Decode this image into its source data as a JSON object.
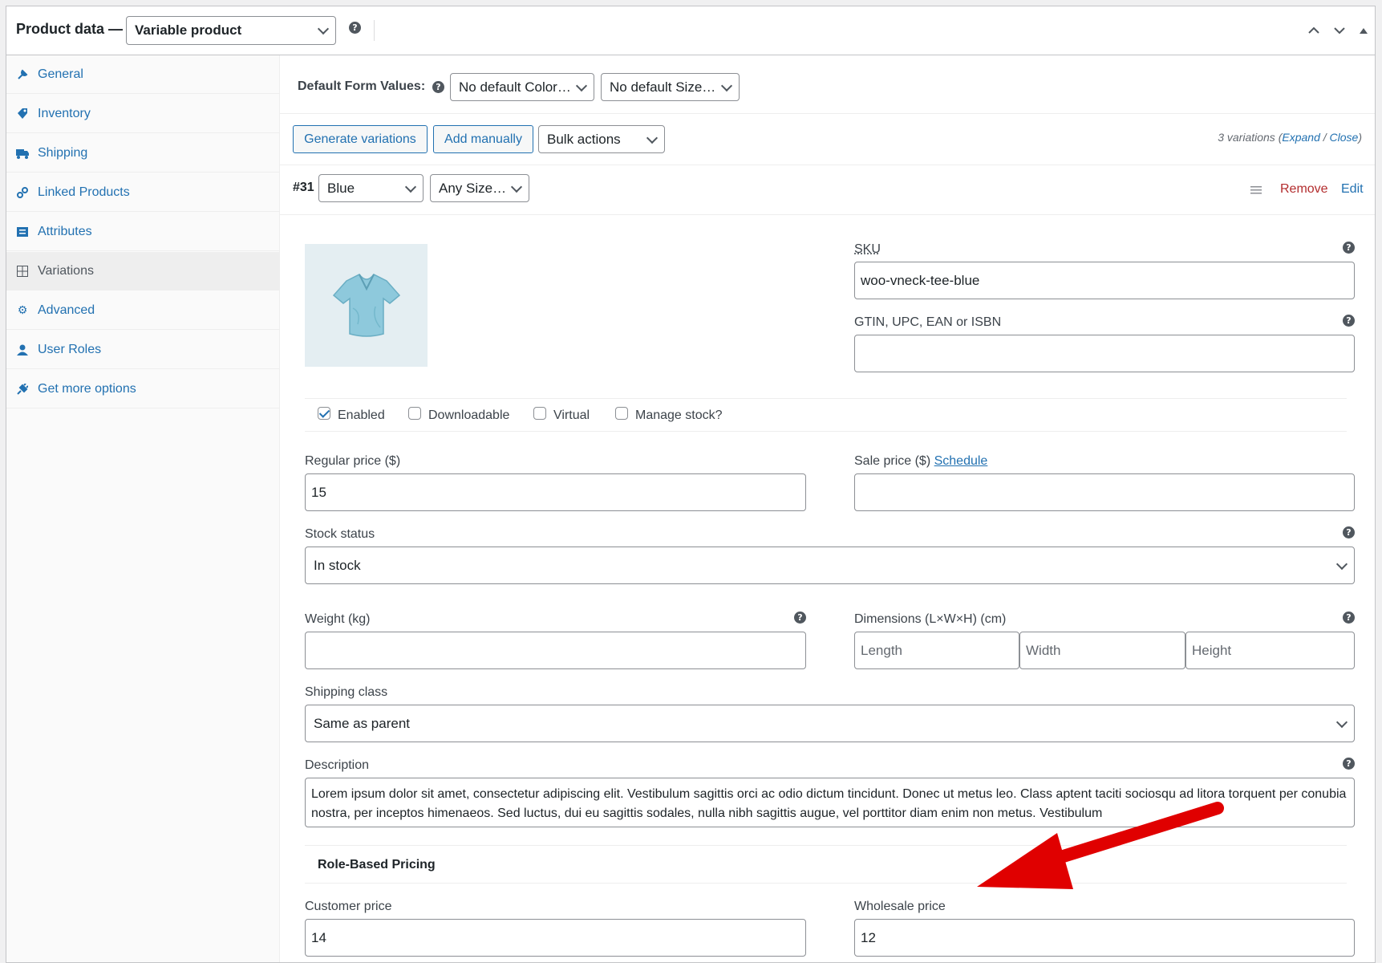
{
  "header": {
    "title": "Product data —",
    "product_type": "Variable product"
  },
  "sidebar": {
    "items": [
      {
        "label": "General",
        "icon": "wrench-icon"
      },
      {
        "label": "Inventory",
        "icon": "tag-icon"
      },
      {
        "label": "Shipping",
        "icon": "truck-icon"
      },
      {
        "label": "Linked Products",
        "icon": "link-icon"
      },
      {
        "label": "Attributes",
        "icon": "list-icon"
      },
      {
        "label": "Variations",
        "icon": "grid-icon"
      },
      {
        "label": "Advanced",
        "icon": "gear-icon"
      },
      {
        "label": "User Roles",
        "icon": "user-icon"
      },
      {
        "label": "Get more options",
        "icon": "plugin-icon"
      }
    ],
    "active": "Variations"
  },
  "defaults": {
    "label": "Default Form Values:",
    "color": "No default Color…",
    "size": "No default Size…"
  },
  "toolbar": {
    "generate": "Generate variations",
    "add_manually": "Add manually",
    "bulk_actions": "Bulk actions",
    "count_text": "3 variations (",
    "expand": "Expand",
    "slash": " / ",
    "close": "Close",
    "paren": ")"
  },
  "variation": {
    "id": "#31",
    "color": "Blue",
    "size": "Any Size…",
    "remove": "Remove",
    "edit": "Edit",
    "sku_label": "SKU",
    "sku_value": "woo-vneck-tee-blue",
    "gtin_label": "GTIN, UPC, EAN or ISBN",
    "gtin_value": "",
    "enabled": "Enabled",
    "downloadable": "Downloadable",
    "virtual": "Virtual",
    "manage_stock": "Manage stock?",
    "regular_price_label": "Regular price ($)",
    "regular_price": "15",
    "sale_price_label": "Sale price ($)",
    "schedule": "Schedule",
    "sale_price": "",
    "stock_status_label": "Stock status",
    "stock_status": "In stock",
    "weight_label": "Weight (kg)",
    "weight": "",
    "dimensions_label": "Dimensions (L×W×H) (cm)",
    "length_ph": "Length",
    "width_ph": "Width",
    "height_ph": "Height",
    "shipping_class_label": "Shipping class",
    "shipping_class": "Same as parent",
    "description_label": "Description",
    "description": "Lorem ipsum dolor sit amet, consectetur adipiscing elit. Vestibulum sagittis orci ac odio dictum tincidunt. Donec ut metus leo. Class aptent taciti sociosqu ad litora torquent per conubia nostra, per inceptos himenaeos. Sed luctus, dui eu sagittis sodales, nulla nibh sagittis augue, vel porttitor diam enim non metus. Vestibulum",
    "role_pricing_heading": "Role-Based Pricing",
    "customer_price_label": "Customer price",
    "customer_price": "14",
    "wholesale_price_label": "Wholesale price",
    "wholesale_price": "12"
  },
  "colors": {
    "link": "#2271b1",
    "remove": "#b32d2e",
    "arrow": "#e00000",
    "tshirt": "#8ec9dc"
  }
}
